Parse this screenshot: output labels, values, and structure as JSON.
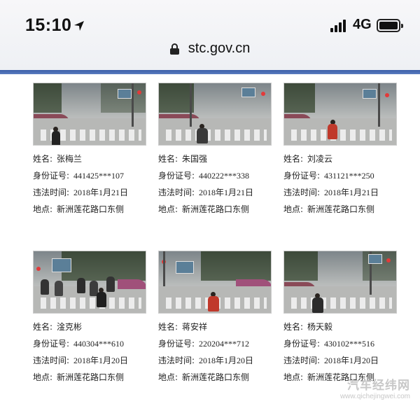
{
  "status_bar": {
    "time": "15:10",
    "network": "4G"
  },
  "browser": {
    "url": "stc.gov.cn"
  },
  "labels": {
    "name": "姓名:",
    "id_number": "身份证号:",
    "violation_time": "违法时间:",
    "location": "地点:"
  },
  "records": [
    {
      "name": "张梅兰",
      "id_number": "441425***107",
      "violation_time": "2018年1月21日",
      "location": "新洲莲花路口东侧"
    },
    {
      "name": "朱国强",
      "id_number": "440222***338",
      "violation_time": "2018年1月21日",
      "location": "新洲莲花路口东侧"
    },
    {
      "name": "刘凌云",
      "id_number": "431121***250",
      "violation_time": "2018年1月21日",
      "location": "新洲莲花路口东侧"
    },
    {
      "name": "淦克彬",
      "id_number": "440304***610",
      "violation_time": "2018年1月20日",
      "location": "新洲莲花路口东侧"
    },
    {
      "name": "蒋安祥",
      "id_number": "220204***712",
      "violation_time": "2018年1月20日",
      "location": "新洲莲花路口东侧"
    },
    {
      "name": "杨天毅",
      "id_number": "430102***516",
      "violation_time": "2018年1月20日",
      "location": "新洲莲花路口东侧"
    }
  ],
  "watermark": {
    "title": "汽车经纬网",
    "url": "www.qichejingwei.com"
  },
  "icons": {
    "location": "location-arrow-icon",
    "signal": "cellular-signal-icon",
    "battery": "battery-icon",
    "lock": "lock-icon"
  }
}
